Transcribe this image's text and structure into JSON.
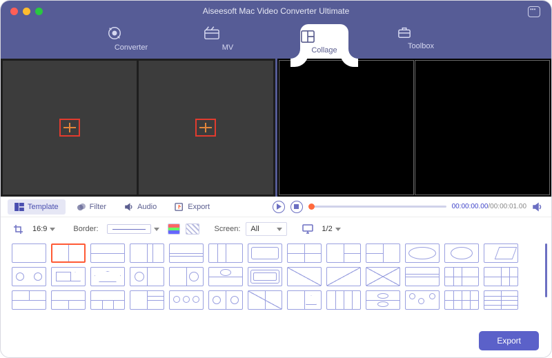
{
  "app": {
    "title": "Aiseesoft Mac Video Converter Ultimate"
  },
  "nav": {
    "converter": "Converter",
    "mv": "MV",
    "collage": "Collage",
    "toolbox": "Toolbox"
  },
  "tabs": {
    "template": "Template",
    "filter": "Filter",
    "audio": "Audio",
    "export": "Export"
  },
  "player": {
    "current": "00:00:00.00",
    "sep": "/",
    "total": "00:00:01.00"
  },
  "options": {
    "ratio": "16:9",
    "border_label": "Border:",
    "screen_label": "Screen:",
    "screen_value": "All",
    "page": "1/2"
  },
  "footer": {
    "export": "Export"
  }
}
